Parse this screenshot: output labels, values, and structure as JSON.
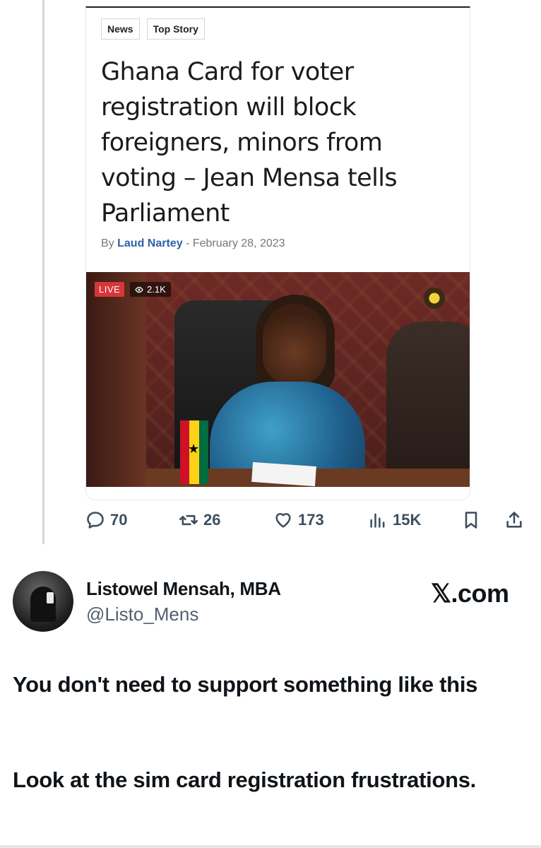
{
  "article": {
    "tags": [
      "News",
      "Top Story"
    ],
    "headline": "Ghana Card for voter registration will block foreigners, minors from voting – Jean Mensa tells Parliament",
    "by_prefix": "By ",
    "author": "Laud Nartey",
    "date_sep": " - ",
    "date": "February 28, 2023",
    "video": {
      "live_label": "LIVE",
      "views": "2.1K"
    }
  },
  "actions": {
    "replies": "70",
    "reposts": "26",
    "likes": "173",
    "views": "15K"
  },
  "author": {
    "display_name": "Listowel Mensah, MBA",
    "handle": "@Listo_Mens",
    "watermark": "𝕏.com"
  },
  "tweet": {
    "line1": "You don't need to support something like this",
    "line2": "Look at the sim card registration frustrations."
  },
  "colors": {
    "text": "#0f1419",
    "muted": "#53606d",
    "author_link": "#2e5fa8",
    "live_badge": "#d8363a"
  }
}
